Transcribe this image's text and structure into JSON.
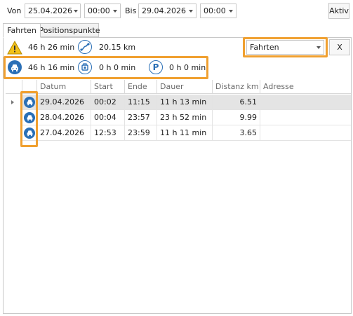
{
  "filter": {
    "from_label": "Von",
    "from_date": "25.04.2026",
    "from_time": "00:00",
    "to_label": "Bis",
    "to_date": "29.04.2026",
    "to_time": "00:00",
    "active_button": "Aktiv"
  },
  "tabs": [
    {
      "label": "Fahrten",
      "active": true
    },
    {
      "label": "Positionspunkte",
      "active": false
    }
  ],
  "summary": {
    "total_time": "46 h 26 min",
    "total_distance": "20.15 km",
    "drive_time": "46 h 16 min",
    "idle_time": "0 h 0 min",
    "parking_time": "0 h 0 min",
    "type_select": "Fahrten",
    "clear_button": "X"
  },
  "icons": {
    "warning": "warning-icon",
    "distance": "route-icon",
    "drive": "car-front-icon",
    "idle": "engine-idle-icon",
    "parking": "parking-icon"
  },
  "colors": {
    "accent_blue": "#2a6fb6",
    "highlight_orange": "#f0a030",
    "warning_yellow": "#f2c21a",
    "selected_row": "#e4e4e4"
  },
  "table": {
    "columns": [
      "",
      "Datum",
      "Start",
      "Ende",
      "Dauer",
      "Distanz km",
      "Adresse"
    ],
    "rows": [
      {
        "datum": "29.04.2026",
        "start": "00:02",
        "ende": "11:15",
        "dauer": "11 h 13 min",
        "distanz": "6.51",
        "adresse": "",
        "selected": true
      },
      {
        "datum": "28.04.2026",
        "start": "00:04",
        "ende": "23:57",
        "dauer": "23 h 52 min",
        "distanz": "9.99",
        "adresse": "",
        "selected": false
      },
      {
        "datum": "27.04.2026",
        "start": "12:53",
        "ende": "23:59",
        "dauer": "11 h 11 min",
        "distanz": "3.65",
        "adresse": "",
        "selected": false
      }
    ]
  }
}
